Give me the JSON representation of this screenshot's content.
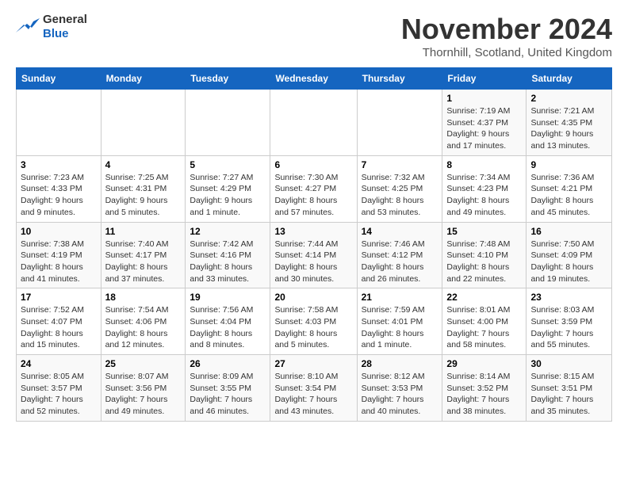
{
  "header": {
    "logo_general": "General",
    "logo_blue": "Blue",
    "month": "November 2024",
    "location": "Thornhill, Scotland, United Kingdom"
  },
  "columns": [
    "Sunday",
    "Monday",
    "Tuesday",
    "Wednesday",
    "Thursday",
    "Friday",
    "Saturday"
  ],
  "weeks": [
    [
      {
        "day": "",
        "info": ""
      },
      {
        "day": "",
        "info": ""
      },
      {
        "day": "",
        "info": ""
      },
      {
        "day": "",
        "info": ""
      },
      {
        "day": "",
        "info": ""
      },
      {
        "day": "1",
        "info": "Sunrise: 7:19 AM\nSunset: 4:37 PM\nDaylight: 9 hours and 17 minutes."
      },
      {
        "day": "2",
        "info": "Sunrise: 7:21 AM\nSunset: 4:35 PM\nDaylight: 9 hours and 13 minutes."
      }
    ],
    [
      {
        "day": "3",
        "info": "Sunrise: 7:23 AM\nSunset: 4:33 PM\nDaylight: 9 hours and 9 minutes."
      },
      {
        "day": "4",
        "info": "Sunrise: 7:25 AM\nSunset: 4:31 PM\nDaylight: 9 hours and 5 minutes."
      },
      {
        "day": "5",
        "info": "Sunrise: 7:27 AM\nSunset: 4:29 PM\nDaylight: 9 hours and 1 minute."
      },
      {
        "day": "6",
        "info": "Sunrise: 7:30 AM\nSunset: 4:27 PM\nDaylight: 8 hours and 57 minutes."
      },
      {
        "day": "7",
        "info": "Sunrise: 7:32 AM\nSunset: 4:25 PM\nDaylight: 8 hours and 53 minutes."
      },
      {
        "day": "8",
        "info": "Sunrise: 7:34 AM\nSunset: 4:23 PM\nDaylight: 8 hours and 49 minutes."
      },
      {
        "day": "9",
        "info": "Sunrise: 7:36 AM\nSunset: 4:21 PM\nDaylight: 8 hours and 45 minutes."
      }
    ],
    [
      {
        "day": "10",
        "info": "Sunrise: 7:38 AM\nSunset: 4:19 PM\nDaylight: 8 hours and 41 minutes."
      },
      {
        "day": "11",
        "info": "Sunrise: 7:40 AM\nSunset: 4:17 PM\nDaylight: 8 hours and 37 minutes."
      },
      {
        "day": "12",
        "info": "Sunrise: 7:42 AM\nSunset: 4:16 PM\nDaylight: 8 hours and 33 minutes."
      },
      {
        "day": "13",
        "info": "Sunrise: 7:44 AM\nSunset: 4:14 PM\nDaylight: 8 hours and 30 minutes."
      },
      {
        "day": "14",
        "info": "Sunrise: 7:46 AM\nSunset: 4:12 PM\nDaylight: 8 hours and 26 minutes."
      },
      {
        "day": "15",
        "info": "Sunrise: 7:48 AM\nSunset: 4:10 PM\nDaylight: 8 hours and 22 minutes."
      },
      {
        "day": "16",
        "info": "Sunrise: 7:50 AM\nSunset: 4:09 PM\nDaylight: 8 hours and 19 minutes."
      }
    ],
    [
      {
        "day": "17",
        "info": "Sunrise: 7:52 AM\nSunset: 4:07 PM\nDaylight: 8 hours and 15 minutes."
      },
      {
        "day": "18",
        "info": "Sunrise: 7:54 AM\nSunset: 4:06 PM\nDaylight: 8 hours and 12 minutes."
      },
      {
        "day": "19",
        "info": "Sunrise: 7:56 AM\nSunset: 4:04 PM\nDaylight: 8 hours and 8 minutes."
      },
      {
        "day": "20",
        "info": "Sunrise: 7:58 AM\nSunset: 4:03 PM\nDaylight: 8 hours and 5 minutes."
      },
      {
        "day": "21",
        "info": "Sunrise: 7:59 AM\nSunset: 4:01 PM\nDaylight: 8 hours and 1 minute."
      },
      {
        "day": "22",
        "info": "Sunrise: 8:01 AM\nSunset: 4:00 PM\nDaylight: 7 hours and 58 minutes."
      },
      {
        "day": "23",
        "info": "Sunrise: 8:03 AM\nSunset: 3:59 PM\nDaylight: 7 hours and 55 minutes."
      }
    ],
    [
      {
        "day": "24",
        "info": "Sunrise: 8:05 AM\nSunset: 3:57 PM\nDaylight: 7 hours and 52 minutes."
      },
      {
        "day": "25",
        "info": "Sunrise: 8:07 AM\nSunset: 3:56 PM\nDaylight: 7 hours and 49 minutes."
      },
      {
        "day": "26",
        "info": "Sunrise: 8:09 AM\nSunset: 3:55 PM\nDaylight: 7 hours and 46 minutes."
      },
      {
        "day": "27",
        "info": "Sunrise: 8:10 AM\nSunset: 3:54 PM\nDaylight: 7 hours and 43 minutes."
      },
      {
        "day": "28",
        "info": "Sunrise: 8:12 AM\nSunset: 3:53 PM\nDaylight: 7 hours and 40 minutes."
      },
      {
        "day": "29",
        "info": "Sunrise: 8:14 AM\nSunset: 3:52 PM\nDaylight: 7 hours and 38 minutes."
      },
      {
        "day": "30",
        "info": "Sunrise: 8:15 AM\nSunset: 3:51 PM\nDaylight: 7 hours and 35 minutes."
      }
    ]
  ]
}
